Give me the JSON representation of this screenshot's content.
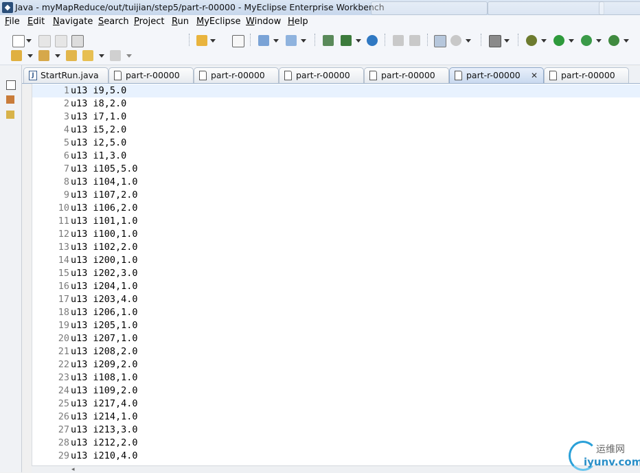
{
  "window": {
    "title": "Java - myMapReduce/out/tuijian/step5/part-r-00000 - MyEclipse Enterprise Workbench",
    "app_icon": "myeclipse-icon"
  },
  "menu": [
    {
      "label": "File"
    },
    {
      "label": "Edit"
    },
    {
      "label": "Navigate"
    },
    {
      "label": "Search"
    },
    {
      "label": "Project"
    },
    {
      "label": "Run"
    },
    {
      "label": "MyEclipse"
    },
    {
      "label": "Window"
    },
    {
      "label": "Help"
    }
  ],
  "tabs": [
    {
      "label": "StartRun.java",
      "icon": "java-file-icon",
      "active": false
    },
    {
      "label": "part-r-00000",
      "icon": "text-file-icon",
      "active": false
    },
    {
      "label": "part-r-00000",
      "icon": "text-file-icon",
      "active": false
    },
    {
      "label": "part-r-00000",
      "icon": "text-file-icon",
      "active": false
    },
    {
      "label": "part-r-00000",
      "icon": "text-file-icon",
      "active": false
    },
    {
      "label": "part-r-00000",
      "icon": "text-file-icon",
      "active": true
    },
    {
      "label": "part-r-00000",
      "icon": "text-file-icon",
      "active": false
    }
  ],
  "active_tab_close": "✕",
  "editor": {
    "lines": [
      {
        "n": "1",
        "text": "u13 i9,5.0"
      },
      {
        "n": "2",
        "text": "u13 i8,2.0"
      },
      {
        "n": "3",
        "text": "u13 i7,1.0"
      },
      {
        "n": "4",
        "text": "u13 i5,2.0"
      },
      {
        "n": "5",
        "text": "u13 i2,5.0"
      },
      {
        "n": "6",
        "text": "u13 i1,3.0"
      },
      {
        "n": "7",
        "text": "u13 i105,5.0"
      },
      {
        "n": "8",
        "text": "u13 i104,1.0"
      },
      {
        "n": "9",
        "text": "u13 i107,2.0"
      },
      {
        "n": "10",
        "text": "u13 i106,2.0"
      },
      {
        "n": "11",
        "text": "u13 i101,1.0"
      },
      {
        "n": "12",
        "text": "u13 i100,1.0"
      },
      {
        "n": "13",
        "text": "u13 i102,2.0"
      },
      {
        "n": "14",
        "text": "u13 i200,1.0"
      },
      {
        "n": "15",
        "text": "u13 i202,3.0"
      },
      {
        "n": "16",
        "text": "u13 i204,1.0"
      },
      {
        "n": "17",
        "text": "u13 i203,4.0"
      },
      {
        "n": "18",
        "text": "u13 i206,1.0"
      },
      {
        "n": "19",
        "text": "u13 i205,1.0"
      },
      {
        "n": "20",
        "text": "u13 i207,1.0"
      },
      {
        "n": "21",
        "text": "u13 i208,2.0"
      },
      {
        "n": "22",
        "text": "u13 i209,2.0"
      },
      {
        "n": "23",
        "text": "u13 i108,1.0"
      },
      {
        "n": "24",
        "text": "u13 i109,2.0"
      },
      {
        "n": "25",
        "text": "u13 i217,4.0"
      },
      {
        "n": "26",
        "text": "u13 i214,1.0"
      },
      {
        "n": "27",
        "text": "u13 i213,3.0"
      },
      {
        "n": "28",
        "text": "u13 i212,2.0"
      },
      {
        "n": "29",
        "text": "u13 i210,4.0"
      }
    ]
  },
  "watermark": {
    "cn": "运维网",
    "en": "iyunv.com"
  },
  "colors": {
    "current_line": "#e8f2fe",
    "line_number": "#7a7a7a",
    "active_tab": "#c9d9ef"
  }
}
